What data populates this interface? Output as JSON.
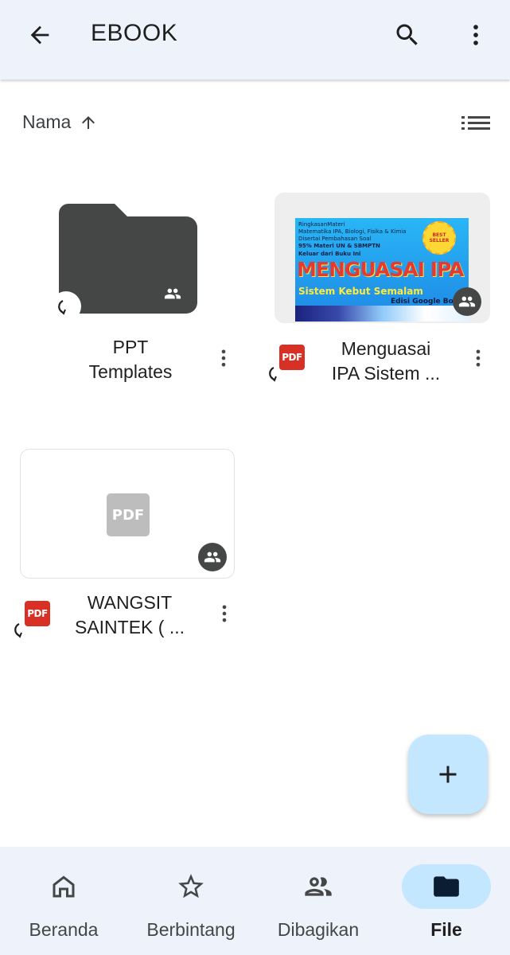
{
  "appbar": {
    "title": "EBOOK",
    "back_icon": "arrow-back-icon",
    "search_icon": "search-icon",
    "more_icon": "more-vert-icon"
  },
  "sort": {
    "label": "Nama",
    "direction_icon": "arrow-up-icon",
    "view_icon": "list-view-icon"
  },
  "files": [
    {
      "type": "folder",
      "title_line1": "PPT",
      "title_line2": "Templates",
      "shared": true,
      "synced": true
    },
    {
      "type": "pdf",
      "title_line1": "Menguasai",
      "title_line2": "IPA Sistem ...",
      "shared": true,
      "synced": true,
      "type_label": "PDF"
    },
    {
      "type": "pdf",
      "title_line1": "WANGSIT",
      "title_line2": "SAINTEK ( ...",
      "shared": true,
      "synced": true,
      "type_label": "PDF",
      "placeholder_label": "PDF"
    }
  ],
  "cover": {
    "line1": "RingkasanMateri",
    "line2": "Matematika IPA, Biologi, Fisika & Kimia",
    "line3": "Disertai Pembahasan Soal",
    "line4": "95% Materi UN & SBMPTN",
    "line5": "Keluar dari Buku Ini",
    "title": "MENGUASAI IPA",
    "subtitle": "Sistem Kebut Semalam",
    "edition": "Edisi Google Books",
    "badge": "BEST SELLER"
  },
  "fab": {
    "icon": "add-icon"
  },
  "nav": [
    {
      "label": "Beranda",
      "icon": "home-icon",
      "active": false
    },
    {
      "label": "Berbintang",
      "icon": "star-icon",
      "active": false
    },
    {
      "label": "Dibagikan",
      "icon": "people-icon",
      "active": false
    },
    {
      "label": "File",
      "icon": "folder-icon",
      "active": true
    }
  ],
  "colors": {
    "bar_bg": "#eef2fa",
    "accent": "#c2e7ff",
    "folder": "#444746",
    "pdf_red": "#d93025"
  }
}
